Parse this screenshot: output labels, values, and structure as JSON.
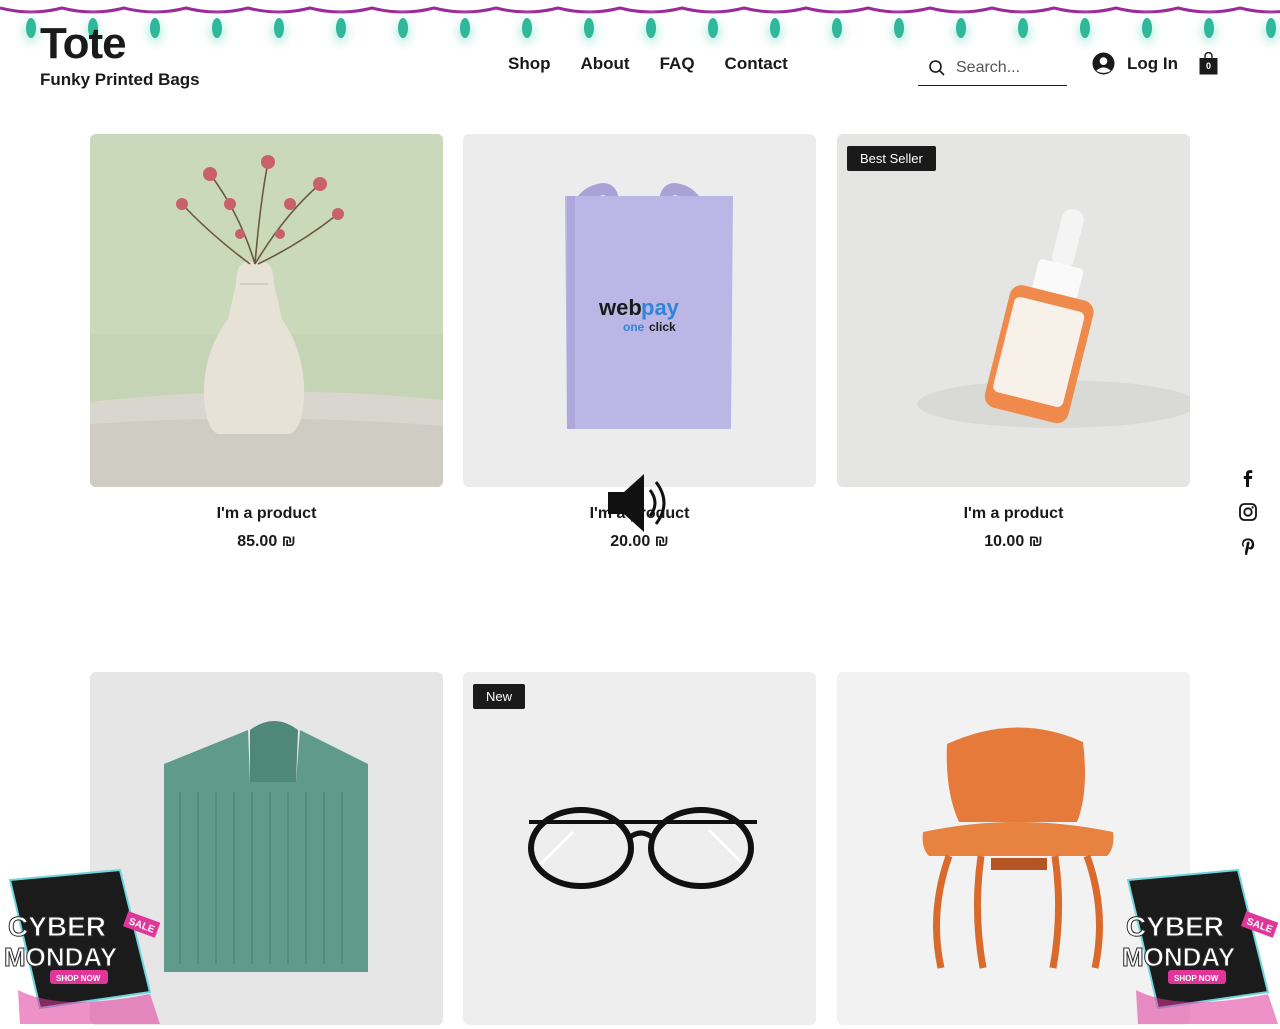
{
  "brand": {
    "title": "Tote",
    "subtitle": "Funky Printed Bags"
  },
  "nav": {
    "items": [
      "Shop",
      "About",
      "FAQ",
      "Contact"
    ]
  },
  "search": {
    "placeholder": "Search...",
    "icon": "search-icon"
  },
  "account": {
    "login_label": "Log In",
    "icon": "user-icon"
  },
  "cart": {
    "count": "0",
    "icon": "shopping-bag-icon"
  },
  "products": [
    {
      "name": "I'm a product",
      "price": "85.00 ₪",
      "ribbon": "",
      "image": "vase-with-dried-roses"
    },
    {
      "name": "I'm a product",
      "price": "20.00 ₪",
      "ribbon": "",
      "image": "lavender-tote-bag",
      "bag_print_word1": "web",
      "bag_print_word2": "pay",
      "bag_print_word3": "one",
      "bag_print_word4": "click"
    },
    {
      "name": "I'm a product",
      "price": "10.00 ₪",
      "ribbon": "Best Seller",
      "image": "orange-serum-bottle"
    },
    {
      "name": "",
      "price": "",
      "ribbon": "",
      "image": "green-knit-sweater"
    },
    {
      "name": "",
      "price": "",
      "ribbon": "New",
      "image": "round-eyeglasses"
    },
    {
      "name": "",
      "price": "",
      "ribbon": "",
      "image": "wooden-chair"
    }
  ],
  "social": [
    "facebook-icon",
    "instagram-icon",
    "pinterest-icon"
  ],
  "overlays": {
    "volume_icon": "speaker-volume-icon",
    "promo": {
      "line1": "CYBER",
      "line2": "MONDAY",
      "tag": "SALE",
      "button": "SHOP NOW"
    }
  },
  "colors": {
    "text": "#1a1a1a",
    "ribbon_bg": "#1a1a1a",
    "lights_wire": "#9a2a9a",
    "lights_bulb": "#2fb89a",
    "promo_pink": "#e0369a"
  }
}
